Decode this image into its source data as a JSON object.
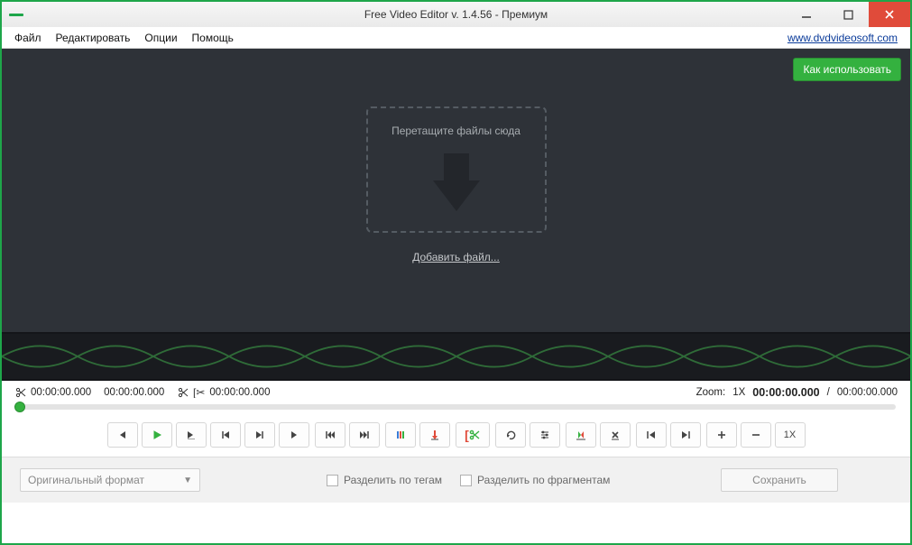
{
  "window": {
    "title": "Free Video Editor v. 1.4.56 - Премиум"
  },
  "menu": {
    "file": "Файл",
    "edit": "Редактировать",
    "options": "Опции",
    "help": "Помощь",
    "url": "www.dvdvideosoft.com"
  },
  "preview": {
    "howto": "Как использовать",
    "drop": "Перетащите файлы сюда",
    "add": "Добавить файл..."
  },
  "time": {
    "start": "00:00:00.000",
    "sel": "00:00:00.000",
    "end": "00:00:00.000",
    "zoom_label": "Zoom:",
    "zoom_val": "1X",
    "cur": "00:00:00.000",
    "sep": "/",
    "total": "00:00:00.000"
  },
  "toolbar": {
    "speed": "1X"
  },
  "footer": {
    "format": "Оригинальный формат",
    "split_tags": "Разделить по тегам",
    "split_frags": "Разделить по фрагментам",
    "save": "Сохранить"
  }
}
